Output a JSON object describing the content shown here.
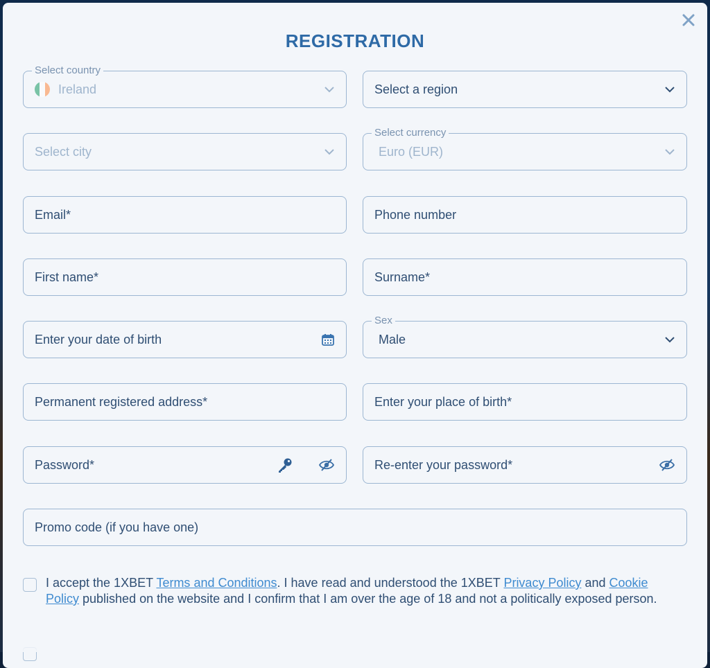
{
  "dialog": {
    "title": "REGISTRATION"
  },
  "country": {
    "label": "Select country",
    "value": "Ireland",
    "flag_colors": [
      "#169b62",
      "#ffffff",
      "#ff883e"
    ]
  },
  "region": {
    "placeholder": "Select a region"
  },
  "city": {
    "placeholder": "Select city"
  },
  "currency": {
    "label": "Select currency",
    "value": "Euro (EUR)"
  },
  "email": {
    "placeholder": "Email*"
  },
  "phone": {
    "placeholder": "Phone number"
  },
  "first_name": {
    "placeholder": "First name*"
  },
  "surname": {
    "placeholder": "Surname*"
  },
  "dob": {
    "placeholder": "Enter your date of birth",
    "icon": "calendar-icon"
  },
  "sex": {
    "label": "Sex",
    "value": "Male"
  },
  "address": {
    "placeholder": "Permanent registered address*"
  },
  "place_of_birth": {
    "placeholder": "Enter your place of birth*"
  },
  "password": {
    "placeholder": "Password*",
    "icons": [
      "key-icon",
      "eye-slash-icon"
    ]
  },
  "password_confirm": {
    "placeholder": "Re-enter your password*",
    "icon": "eye-slash-icon"
  },
  "promo": {
    "placeholder": "Promo code (if you have one)"
  },
  "consent": {
    "part1": "I accept the 1XBET ",
    "terms_link": "Terms and Conditions",
    "part2": ". I have read and understood the 1XBET ",
    "privacy_link": "Privacy Policy",
    "part3": " and ",
    "cookie_link": "Cookie Policy",
    "part4": " published on the website and I confirm that I am over the age of 18 and not a politically exposed person."
  },
  "colors": {
    "accent": "#2e6aa6",
    "link": "#3f8bd0",
    "border": "#9cb6d2",
    "text": "#2f4e73",
    "muted": "#9fb5cd",
    "background": "#f3f6fa"
  }
}
